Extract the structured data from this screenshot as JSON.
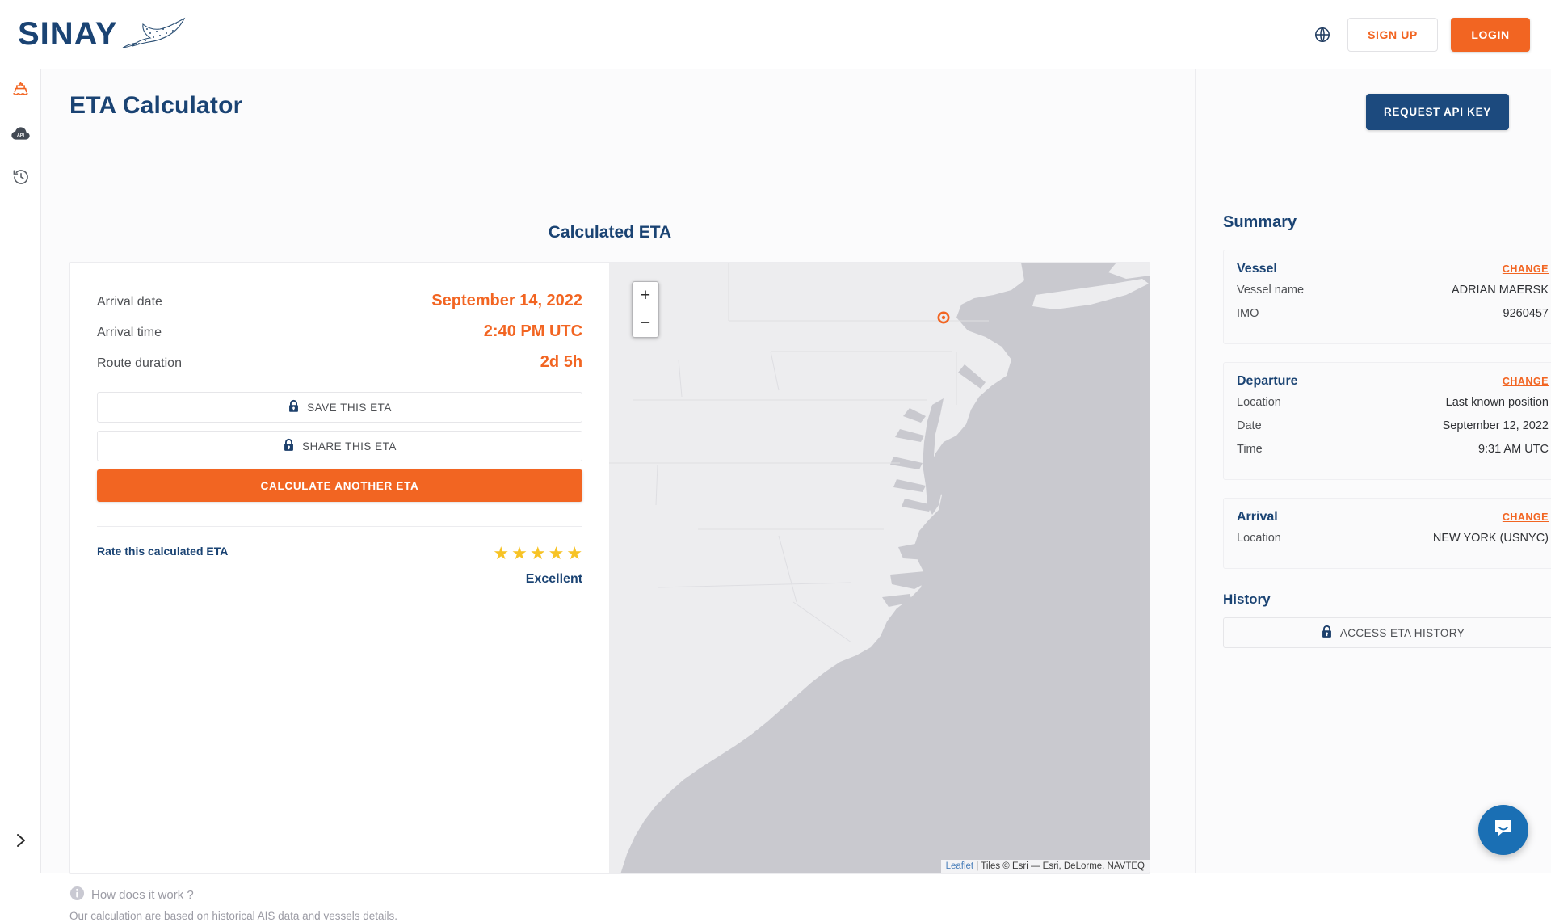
{
  "header": {
    "logo_text": "SINAY",
    "logo_icon": "dolphin-logo-icon",
    "lang_icon": "globe-icon",
    "signup_label": "SIGN UP",
    "login_label": "LOGIN"
  },
  "rail": {
    "items": [
      {
        "icon": "ship-icon",
        "name": "eta-calculator",
        "active": true
      },
      {
        "icon": "api-cloud-icon",
        "name": "api",
        "active": false
      },
      {
        "icon": "history-clock-icon",
        "name": "history",
        "active": false
      }
    ],
    "expand_icon": "chevron-right-icon"
  },
  "page": {
    "title": "ETA Calculator",
    "api_key_button": "REQUEST API KEY",
    "calculated_eta_title": "Calculated ETA"
  },
  "details": {
    "rows": [
      {
        "label": "Arrival date",
        "value": "September 14, 2022"
      },
      {
        "label": "Arrival time",
        "value": "2:40 PM UTC"
      },
      {
        "label": "Route duration",
        "value": "2d 5h"
      }
    ],
    "save_label": "SAVE THIS ETA",
    "share_label": "SHARE THIS ETA",
    "calculate_label": "CALCULATE ANOTHER ETA",
    "lock_icon": "lock-icon"
  },
  "rating": {
    "label": "Rate this calculated ETA",
    "stars_filled": 5,
    "stars_total": 5,
    "star_glyph": "★",
    "word": "Excellent"
  },
  "map": {
    "zoom_in": "+",
    "zoom_out": "−",
    "zoom_in_icon": "plus-icon",
    "zoom_out_icon": "minus-icon",
    "attribution_link": "Leaflet",
    "attribution_rest": " | Tiles © Esri — Esri, DeLorme, NAVTEQ",
    "vessel_marker_icon": "vessel-triangle-marker",
    "destination_marker_icon": "destination-circle-marker"
  },
  "footnote": {
    "info_icon": "info-icon",
    "title": "How does it work ?",
    "subtitle": "Our calculation are based on historical AIS data and vessels details."
  },
  "summary": {
    "title": "Summary",
    "change_label": "CHANGE",
    "cards": [
      {
        "title": "Vessel",
        "rows": [
          {
            "key": "Vessel name",
            "value": "ADRIAN MAERSK"
          },
          {
            "key": "IMO",
            "value": "9260457"
          }
        ]
      },
      {
        "title": "Departure",
        "rows": [
          {
            "key": "Location",
            "value": "Last known position"
          },
          {
            "key": "Date",
            "value": "September 12, 2022"
          },
          {
            "key": "Time",
            "value": "9:31 AM UTC"
          }
        ]
      },
      {
        "title": "Arrival",
        "rows": [
          {
            "key": "Location",
            "value": "NEW YORK (USNYC)"
          }
        ]
      }
    ],
    "history_title": "History",
    "history_button": "ACCESS ETA HISTORY",
    "history_lock_icon": "lock-icon"
  },
  "chat": {
    "icon": "chat-bubble-icon"
  },
  "colors": {
    "accent_orange": "#f26522",
    "brand_navy": "#1a4373",
    "button_navy": "#1c4a7e",
    "star_yellow": "#f7c325",
    "chat_blue": "#1a6fb4",
    "map_sea": "#c9c9cf",
    "map_land": "#ededef"
  }
}
